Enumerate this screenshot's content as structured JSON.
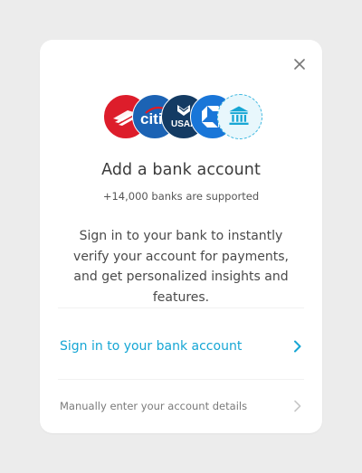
{
  "modal": {
    "title": "Add a bank account",
    "subtitle": "+14,000 banks are supported",
    "description": "Sign in to your bank to instantly verify your account for payments, and get personalized insights and features.",
    "primary_action": "Sign in to your bank account",
    "secondary_action": "Manually enter your account details"
  },
  "bank_logos": [
    {
      "icon": "bank-of-america-logo",
      "color": "#dd1d2b"
    },
    {
      "icon": "citi-logo",
      "text": "citi",
      "color": "#1c63b4"
    },
    {
      "icon": "usaa-logo",
      "text": "USAA",
      "color": "#143b63"
    },
    {
      "icon": "chase-logo",
      "color": "#1976d8"
    },
    {
      "icon": "bank-building-icon",
      "color": "#e8f7fc"
    }
  ],
  "colors": {
    "accent": "#16a6d4",
    "background": "#ececec",
    "card": "#ffffff"
  }
}
